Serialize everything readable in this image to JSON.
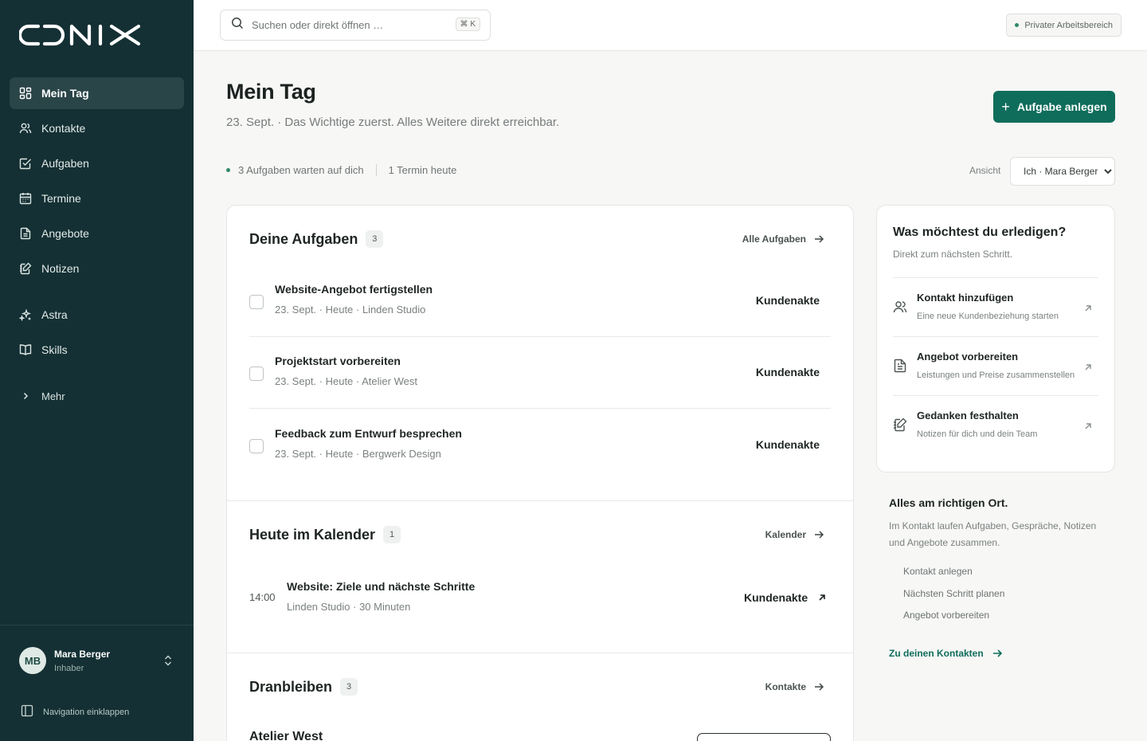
{
  "brand": {
    "logo_text": "CONIX"
  },
  "sidebar": {
    "items": [
      {
        "label": "Mein Tag",
        "icon": "grid-icon",
        "active": true
      },
      {
        "label": "Kontakte",
        "icon": "users-icon"
      },
      {
        "label": "Aufgaben",
        "icon": "checkbox-icon"
      },
      {
        "label": "Termine",
        "icon": "calendar-icon"
      },
      {
        "label": "Angebote",
        "icon": "document-icon"
      },
      {
        "label": "Notizen",
        "icon": "notes-icon"
      },
      {
        "label": "Astra",
        "icon": "sparkle-icon"
      },
      {
        "label": "Skills",
        "icon": "book-icon"
      }
    ],
    "more_label": "Mehr",
    "user": {
      "initials": "MB",
      "name": "Mara Berger",
      "role": "Inhaber"
    },
    "collapse_label": "Navigation einklappen"
  },
  "topbar": {
    "search_placeholder": "Suchen oder direkt öffnen …",
    "shortcut": "⌘ K",
    "workspace": "Privater Arbeitsbereich"
  },
  "header": {
    "title": "Mein Tag",
    "subtitle": "23. Sept. · Das Wichtige zuerst. Alles Weitere direkt erreichbar.",
    "primary_button": "Aufgabe anlegen",
    "stat_tasks": "3 Aufgaben warten auf dich",
    "stat_events": "1 Termin heute",
    "view_label": "Ansicht",
    "view_value": "Ich · Mara Berger"
  },
  "tasks": {
    "title": "Deine Aufgaben",
    "count": "3",
    "link": "Alle Aufgaben",
    "items": [
      {
        "title": "Website-Angebot fertigstellen",
        "meta": "23. Sept. · Heute · Linden Studio",
        "link": "Kundenakte"
      },
      {
        "title": "Projektstart vorbereiten",
        "meta": "23. Sept. · Heute · Atelier West",
        "link": "Kundenakte"
      },
      {
        "title": "Feedback zum Entwurf besprechen",
        "meta": "23. Sept. · Heute · Bergwerk Design",
        "link": "Kundenakte"
      }
    ]
  },
  "calendar": {
    "title": "Heute im Kalender",
    "count": "1",
    "link": "Kalender",
    "event": {
      "time": "14:00",
      "title": "Website: Ziele und nächste Schritte",
      "meta": "Linden Studio · 30 Minuten",
      "link": "Kundenakte"
    }
  },
  "followup": {
    "title": "Dranbleiben",
    "count": "3",
    "link": "Kontakte",
    "first_item": "Atelier West"
  },
  "actions": {
    "title": "Was möchtest du erledigen?",
    "subtitle": "Direkt zum nächsten Schritt.",
    "items": [
      {
        "title": "Kontakt hinzufügen",
        "sub": "Eine neue Kundenbeziehung starten",
        "icon": "user-add-icon"
      },
      {
        "title": "Angebot vorbereiten",
        "sub": "Leistungen und Preise zusammenstellen",
        "icon": "document-icon"
      },
      {
        "title": "Gedanken festhalten",
        "sub": "Notizen für dich und dein Team",
        "icon": "notes-icon"
      }
    ]
  },
  "info": {
    "title": "Alles am richtigen Ort.",
    "text": "Im Kontakt laufen Aufgaben, Gespräche, Notizen und Angebote zusammen.",
    "list": [
      "Kontakt anlegen",
      "Nächsten Schritt planen",
      "Angebot vorbereiten"
    ],
    "link": "Zu deinen Kontakten"
  },
  "colors": {
    "sidebar_bg": "#143034",
    "accent": "#0f6d5b",
    "active_item": "#2a4548"
  }
}
